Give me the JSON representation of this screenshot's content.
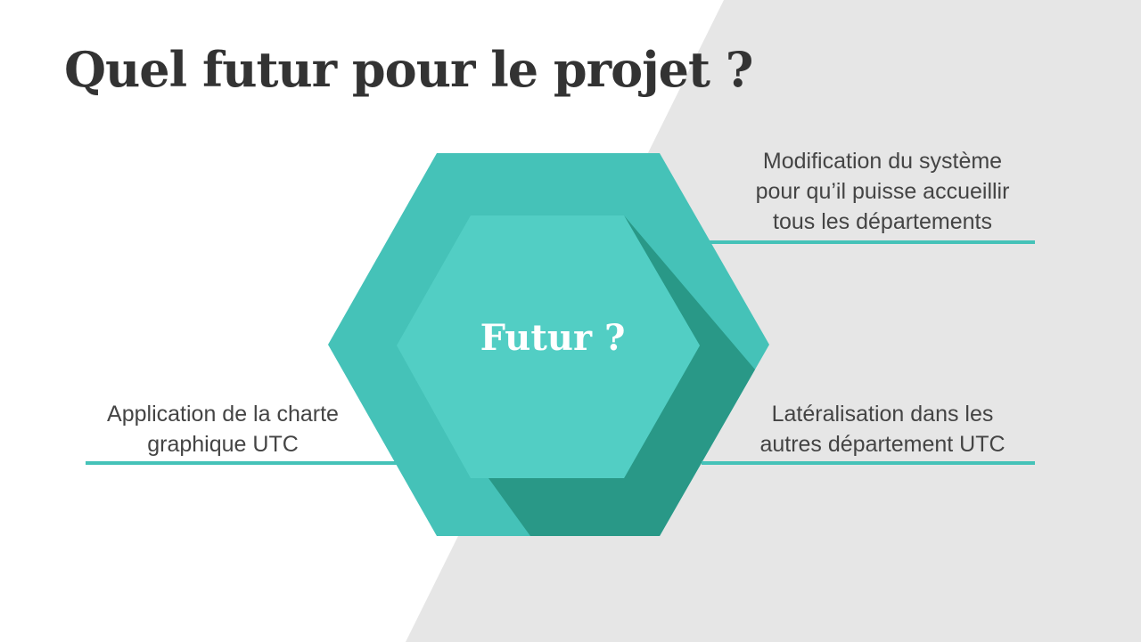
{
  "slide": {
    "title": "Quel futur pour le projet ?",
    "center_label": "Futur ?",
    "notes": {
      "top_right": [
        "Modification du système",
        "pour qu’il puisse accueillir",
        "tous les départements"
      ],
      "bottom_right": [
        "Latéralisation dans les",
        "autres département UTC"
      ],
      "left": [
        "Application de la charte",
        "graphique UTC"
      ]
    }
  },
  "colors": {
    "background": "#ffffff",
    "gray_band": "#e6e6e6",
    "hex_outer": "#45c2b8",
    "hex_inner": "#52cec4",
    "hex_shadow": "#299887",
    "rule": "#45c2b8",
    "title_text": "#333333",
    "body_text": "#444444"
  }
}
